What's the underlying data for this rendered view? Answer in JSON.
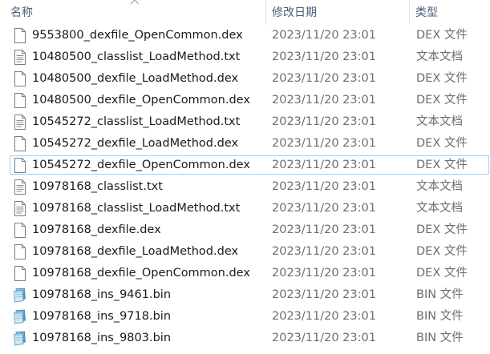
{
  "columns": {
    "name": "名称",
    "date": "修改日期",
    "type": "类型"
  },
  "files": [
    {
      "name": "9553800_dexfile_OpenCommon.dex",
      "date": "2023/11/20 23:01",
      "type": "DEX 文件",
      "icon": "blank-file-icon",
      "selected": false
    },
    {
      "name": "10480500_classlist_LoadMethod.txt",
      "date": "2023/11/20 23:01",
      "type": "文本文档",
      "icon": "text-file-icon",
      "selected": false
    },
    {
      "name": "10480500_dexfile_LoadMethod.dex",
      "date": "2023/11/20 23:01",
      "type": "DEX 文件",
      "icon": "blank-file-icon",
      "selected": false
    },
    {
      "name": "10480500_dexfile_OpenCommon.dex",
      "date": "2023/11/20 23:01",
      "type": "DEX 文件",
      "icon": "blank-file-icon",
      "selected": false
    },
    {
      "name": "10545272_classlist_LoadMethod.txt",
      "date": "2023/11/20 23:01",
      "type": "文本文档",
      "icon": "text-file-icon",
      "selected": false
    },
    {
      "name": "10545272_dexfile_LoadMethod.dex",
      "date": "2023/11/20 23:01",
      "type": "DEX 文件",
      "icon": "blank-file-icon",
      "selected": false
    },
    {
      "name": "10545272_dexfile_OpenCommon.dex",
      "date": "2023/11/20 23:01",
      "type": "DEX 文件",
      "icon": "blank-file-icon",
      "selected": true
    },
    {
      "name": "10978168_classlist.txt",
      "date": "2023/11/20 23:01",
      "type": "文本文档",
      "icon": "text-file-icon",
      "selected": false
    },
    {
      "name": "10978168_classlist_LoadMethod.txt",
      "date": "2023/11/20 23:01",
      "type": "文本文档",
      "icon": "text-file-icon",
      "selected": false
    },
    {
      "name": "10978168_dexfile.dex",
      "date": "2023/11/20 23:01",
      "type": "DEX 文件",
      "icon": "blank-file-icon",
      "selected": false
    },
    {
      "name": "10978168_dexfile_LoadMethod.dex",
      "date": "2023/11/20 23:01",
      "type": "DEX 文件",
      "icon": "blank-file-icon",
      "selected": false
    },
    {
      "name": "10978168_dexfile_OpenCommon.dex",
      "date": "2023/11/20 23:01",
      "type": "DEX 文件",
      "icon": "blank-file-icon",
      "selected": false
    },
    {
      "name": "10978168_ins_9461.bin",
      "date": "2023/11/20 23:01",
      "type": "BIN 文件",
      "icon": "binary-file-icon",
      "selected": false
    },
    {
      "name": "10978168_ins_9718.bin",
      "date": "2023/11/20 23:01",
      "type": "BIN 文件",
      "icon": "binary-file-icon",
      "selected": false
    },
    {
      "name": "10978168_ins_9803.bin",
      "date": "2023/11/20 23:01",
      "type": "BIN 文件",
      "icon": "binary-file-icon",
      "selected": false
    }
  ],
  "colors": {
    "header_text": "#4c607a",
    "name_text": "#1a1a1a",
    "meta_text": "#6d6d6d",
    "selection_border": "#99d1ff"
  }
}
